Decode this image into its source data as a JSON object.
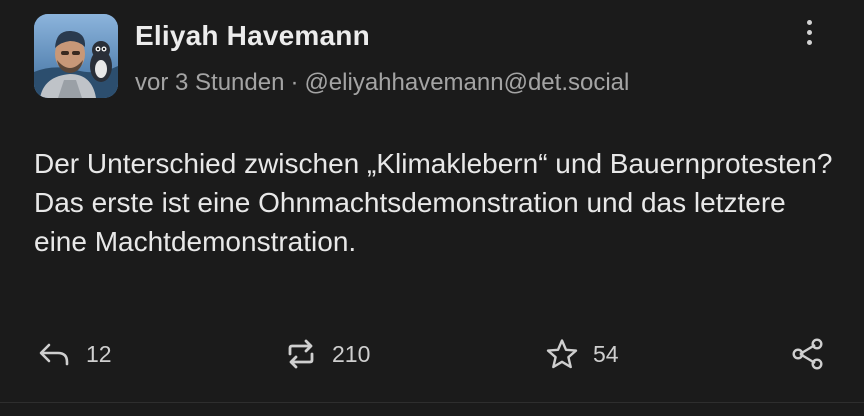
{
  "post": {
    "author": {
      "display_name": "Eliyah Havemann",
      "handle": "@eliyahhavemann@det.social"
    },
    "timestamp": "vor 3 Stunden",
    "separator": "·",
    "content": {
      "line1": "Der Unterschied zwischen „Klimaklebern“ und Bauernprotesten?",
      "line2": "Das erste ist eine Ohnmachtsdemonstration und das letztere eine Machtdemonstration."
    },
    "actions": {
      "reply": {
        "icon": "reply-icon",
        "count": "12"
      },
      "boost": {
        "icon": "boost-icon",
        "count": "210"
      },
      "favourite": {
        "icon": "star-icon",
        "count": "54"
      },
      "share": {
        "icon": "share-icon"
      }
    },
    "menu_icon": "more-vertical-icon"
  },
  "colors": {
    "background": "#1b1b1b",
    "text_primary": "#e8e8e8",
    "text_secondary": "#a4a4a4",
    "icon": "#cfcfcf"
  }
}
